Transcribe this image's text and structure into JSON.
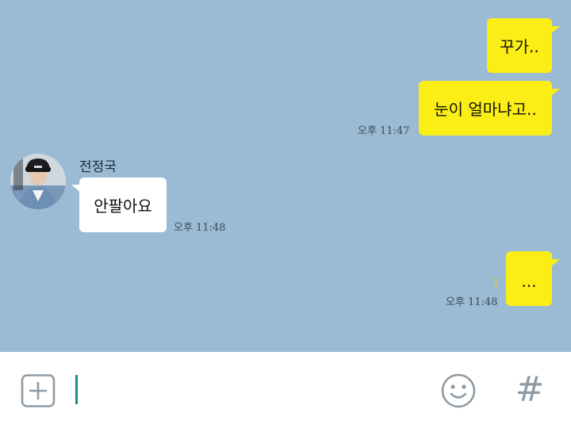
{
  "messages": {
    "mine_1": {
      "text": "꾸가..",
      "read_mark": ""
    },
    "mine_2": {
      "text": "눈이 얼마냐고..",
      "time": "오후 11:47"
    },
    "theirs_1": {
      "sender": "전정국",
      "text": "안팔아요",
      "time": "오후 11:48"
    },
    "mine_3": {
      "text": "...",
      "unread": "1",
      "time": "오후 11:48"
    }
  },
  "input": {
    "add_icon": "plus-square-icon",
    "emoji_icon": "smiley-icon",
    "hash_label": "#"
  },
  "colors": {
    "chat_bg": "#9bbbd4",
    "my_bubble": "#fbee16",
    "their_bubble": "#ffffff",
    "cursor": "#1d8f83"
  }
}
